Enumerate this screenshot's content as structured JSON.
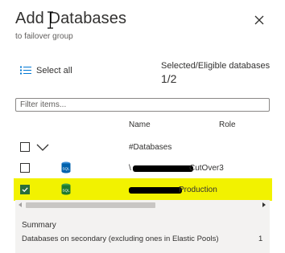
{
  "panel": {
    "title": "Add Databases",
    "subtitle": "to failover group",
    "close_icon": "close-icon"
  },
  "selection": {
    "select_all_label": "Select all",
    "selected_label": "Selected/Eligible databases",
    "selected_count": "1/2"
  },
  "filter": {
    "placeholder": "Filter items...",
    "value": ""
  },
  "table": {
    "columns": [
      "Name",
      "Role"
    ],
    "group_row": {
      "name": "#Databases",
      "checked": false,
      "expanded": true
    },
    "rows": [
      {
        "name_visible": "CutOver3",
        "name_prefix_visible": "\\",
        "checked": false,
        "icon": "sql-database-icon",
        "highlighted": false
      },
      {
        "name_visible": "Production",
        "checked": true,
        "icon": "sql-database-icon",
        "highlighted": true
      }
    ]
  },
  "summary": {
    "title": "Summary",
    "text": "Databases on secondary (excluding ones in Elastic Pools)",
    "value": "1"
  },
  "colors": {
    "accent_blue": "#0078d4",
    "highlight": "#f2f200",
    "checkbox_checked": "#2a6f3a"
  }
}
